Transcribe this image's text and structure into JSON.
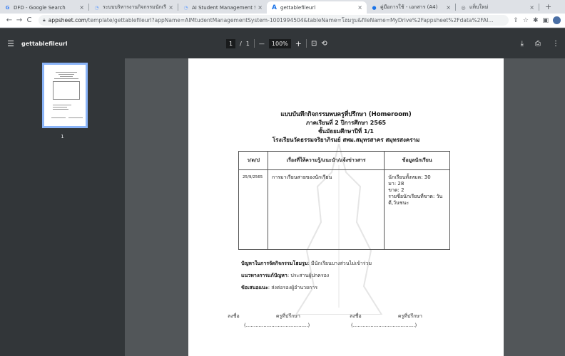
{
  "browser": {
    "tabs": [
      {
        "title": "DFD - Google Search",
        "icon": "google-icon",
        "active": false
      },
      {
        "title": "ระบบบริหารงานกิจกรรมนักเรียน",
        "icon": "appsheet-icon",
        "active": false
      },
      {
        "title": "AI Student Management Sy",
        "icon": "appsheet-icon",
        "active": false
      },
      {
        "title": "gettablefileurl",
        "icon": "appsheet-a-icon",
        "active": true
      },
      {
        "title": "คู่มือการใช้ - เอกสาร (A4)",
        "icon": "web-icon",
        "active": false
      },
      {
        "title": "แท็บใหม่",
        "icon": "chrome-icon",
        "active": false
      }
    ],
    "new_tab": "+",
    "tab_close": "×",
    "url_host": "appsheet.com",
    "url_path": "/template/gettablefileurl?appName=AIMtudentManagementSystem-1001994504&tableName=โฮมรูม&fileName=MyDrive%2Fappsheet%2Fdata%2FAI..."
  },
  "pdf_toolbar": {
    "title": "gettablefileurl",
    "page_current": "1",
    "page_sep": "/",
    "page_total": "1",
    "zoom_minus": "—",
    "zoom": "100%",
    "zoom_plus": "+"
  },
  "sidebar": {
    "thumb_label": "1"
  },
  "document": {
    "title": "แบบบันทึกกิจกรรมพบครูที่ปรึกษา (Homeroom)",
    "term": "ภาคเรียนที่  2  ปีการศึกษา 2565",
    "grade": "ชั้นมัธยมศึกษาปีที่ 1/1",
    "school": "โรงเรียนวัดธรรมจริยาภิรมย์ สพม.สมุทรสาคร สมุทรสงคราม",
    "table": {
      "headers": [
        "ว/ด/ป",
        "เรื่องที่ให้ความรู้/แนะนำ/แจ้งข่าวสาร",
        "ข้อมูลนักเรียน"
      ],
      "row": {
        "date": "25/9/2565",
        "topic": "การมาเรียนสายของนักเรียน",
        "info_lines": [
          "นักเรียนทั้งหมด: 30",
          "มา: 28",
          "ขาด: 2",
          "รายชื่อนักเรียนที่ขาด: วัน",
          "ดี,วันชนะ"
        ]
      }
    },
    "problem_label": "ปัญหาในการจัดกิจกรรมโฮมรูม",
    "problem_text": ": มีนักเรียนบางส่วนไม่เข้าร่วม",
    "solution_label": "แนวทางการแก้ปัญหา",
    "solution_text": ": ประสานผู้ปกครอง",
    "suggest_label": "ข้อเสนอแนะ",
    "suggest_text": ": ส่งต่อรองผู้อำนวยการ",
    "sign_left": "ลงชื่อ                       ครูที่ปรึกษา",
    "sign_right": "ลงชื่อ                       ครูที่ปรึกษา",
    "sign_left_paren": "(.......................................)",
    "sign_right_paren": "(.......................................)"
  }
}
